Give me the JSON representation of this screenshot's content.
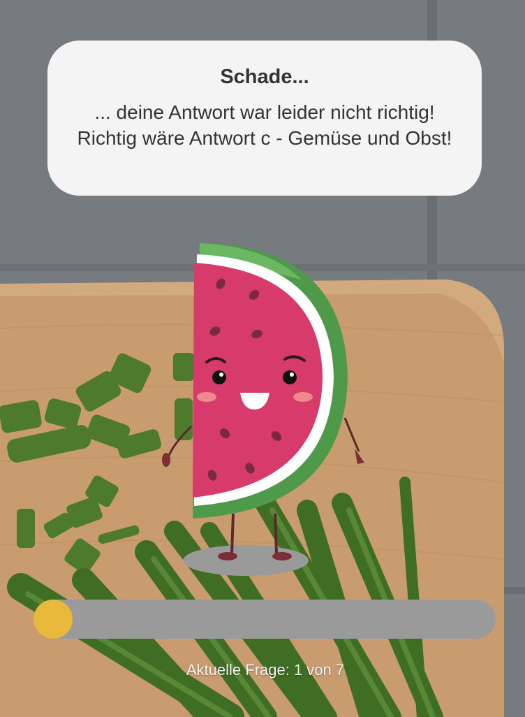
{
  "feedback": {
    "title": "Schade...",
    "message": "... deine Antwort war leider nicht richtig! Richtig wäre Antwort c - Gemüse und Obst!"
  },
  "mascot": {
    "icon": "watermelon-mascot-icon"
  },
  "progress": {
    "label": "Aktuelle Frage: 1 von 7",
    "current": 1,
    "total": 7,
    "fill_fraction": 0.08,
    "track_color": "#9a9a9a",
    "fill_color": "#e8b93a"
  },
  "background": {
    "scene": "chives-on-cutting-board"
  }
}
